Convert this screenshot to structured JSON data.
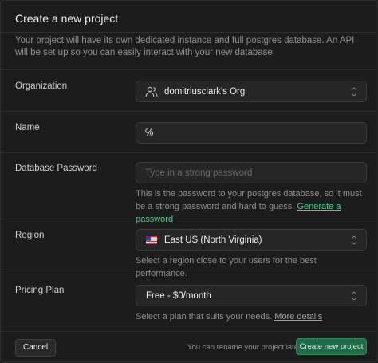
{
  "dialog": {
    "title": "Create a new project",
    "description": "Your project will have its own dedicated instance and full postgres database. An API will be set up so you can easily interact with your new database."
  },
  "organization": {
    "label": "Organization",
    "value": "domitriusclark's Org",
    "icon": "users-icon"
  },
  "name": {
    "label": "Name",
    "value": "%"
  },
  "password": {
    "label": "Database Password",
    "placeholder": "Type in a strong password",
    "help": "This is the password to your postgres database, so it must be a strong password and hard to guess.",
    "generate_link": "Generate a password"
  },
  "region": {
    "label": "Region",
    "value": "East US (North Virginia)",
    "flag": "us-flag-icon",
    "help": "Select a region close to your users for the best performance."
  },
  "pricing": {
    "label": "Pricing Plan",
    "value": "Free - $0/month",
    "help": "Select a plan that suits your needs.",
    "more_link": "More details"
  },
  "footer": {
    "cancel_label": "Cancel",
    "note": "You can rename your project later",
    "create_label": "Create new project"
  },
  "colors": {
    "accent": "#3ecf8e",
    "background": "#1c1c1c",
    "field": "#262626"
  }
}
